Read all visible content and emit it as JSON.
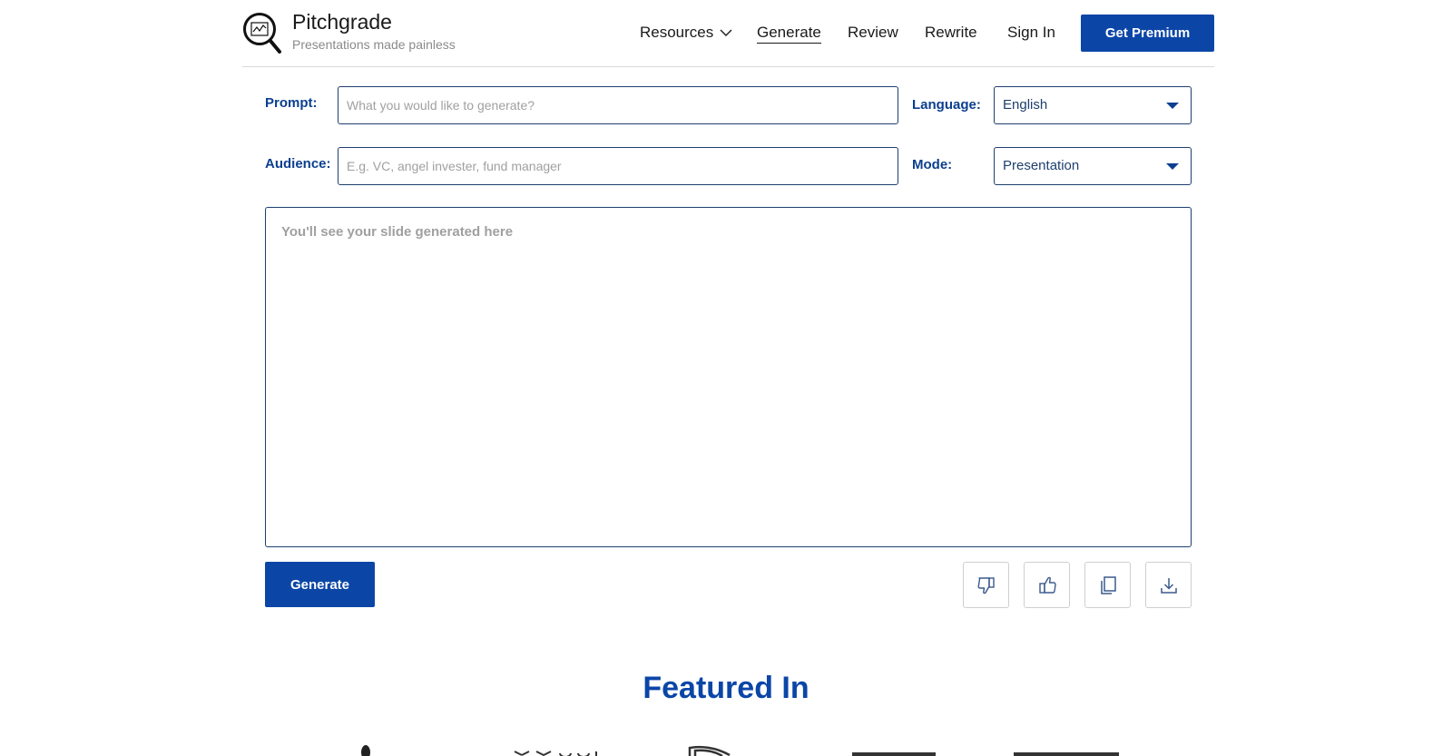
{
  "brand": {
    "name": "Pitchgrade",
    "tagline": "Presentations made painless"
  },
  "nav": {
    "resources": "Resources",
    "generate": "Generate",
    "review": "Review",
    "rewrite": "Rewrite",
    "sign_in": "Sign In",
    "premium": "Get Premium"
  },
  "form": {
    "prompt_label": "Prompt:",
    "prompt_placeholder": "What you would like to generate?",
    "audience_label": "Audience:",
    "audience_placeholder": "E.g. VC, angel invester, fund manager",
    "language_label": "Language:",
    "language_value": "English",
    "mode_label": "Mode:",
    "mode_value": "Presentation",
    "output_placeholder": "You'll see your slide generated here",
    "generate_button": "Generate"
  },
  "actions": {
    "icons": [
      "thumbs-down-icon",
      "thumbs-up-icon",
      "copy-icon",
      "download-icon"
    ]
  },
  "featured": {
    "title": "Featured In"
  },
  "colors": {
    "brand_blue": "#0b46a7",
    "label_blue": "#0b3f8f",
    "border": "#1e3f6e"
  }
}
